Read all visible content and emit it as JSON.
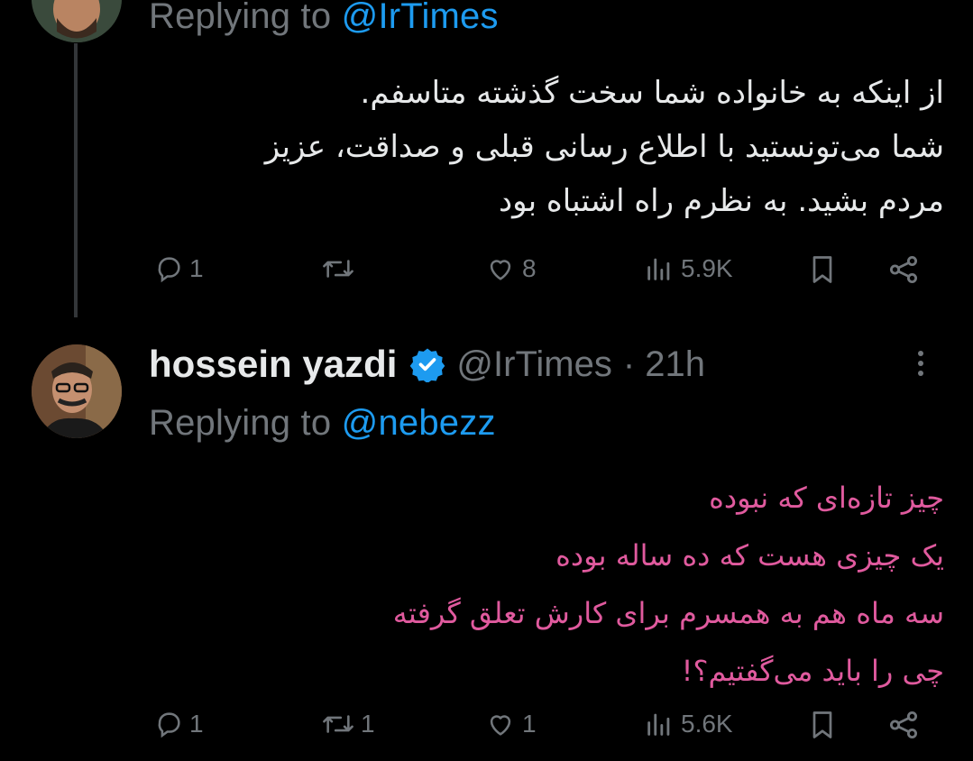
{
  "tweet1": {
    "replying_label": "Replying to",
    "replying_handle": "@IrTimes",
    "lines": [
      "از اینکه به خانواده شما سخت گذشته متاسفم.",
      "شما می‌تونستید با اطلاع رسانی قبلی و صداقت، عزیز",
      "مردم بشید. به نظرم راه اشتباه بود"
    ],
    "actions": {
      "replies": "1",
      "retweets": "",
      "likes": "8",
      "views": "5.9K"
    }
  },
  "tweet2": {
    "name": "hossein yazdi",
    "handle": "@IrTimes",
    "time": "· 21h",
    "replying_label": "Replying to",
    "replying_handle": "@nebezz",
    "lines": [
      "چیز تازه‌ای که نبوده",
      "یک چیزی هست که ده ساله بوده",
      "سه ماه هم به همسرم برای کارش تعلق گرفته",
      "چی را باید می‌گفتیم؟!"
    ],
    "actions": {
      "replies": "1",
      "retweets": "1",
      "likes": "1",
      "views": "5.6K"
    }
  },
  "icons": {
    "reply": "reply-icon",
    "retweet": "retweet-icon",
    "like": "heart-icon",
    "views": "views-icon",
    "bookmark": "bookmark-icon",
    "share": "share-icon",
    "verified": "verified-badge-icon",
    "more": "more-options-icon"
  },
  "colors": {
    "background": "#000000",
    "text": "#e7e9ea",
    "muted": "#71767b",
    "link": "#1d9bf0",
    "pink_text": "#e05a9e",
    "verified": "#1d9bf0"
  }
}
